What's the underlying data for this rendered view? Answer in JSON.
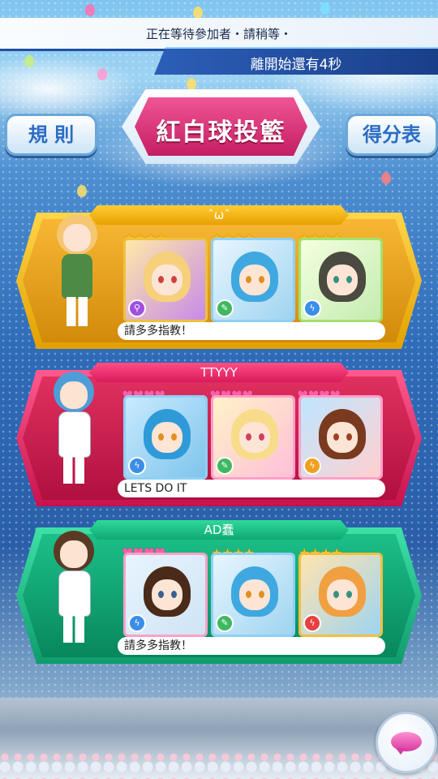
{
  "header": {
    "waiting_text": "正在等待參加者・請稍等・",
    "countdown_text": "離開始還有4秒"
  },
  "buttons": {
    "rules_label": "規 則",
    "scoreboard_label": "得分表"
  },
  "mode_title": "紅白球投籃",
  "players": [
    {
      "name": "ˆωˆ",
      "theme": "gold",
      "message": "請多多指教！",
      "cards": [
        {
          "rating_type": "star",
          "rating": 4,
          "skill_icon": "magnifier-icon",
          "skill_color": "#a050e0"
        },
        {
          "rating_type": "star",
          "rating": 4,
          "skill_icon": "wrench-icon",
          "skill_color": "#3fb860"
        },
        {
          "rating_type": "star",
          "rating": 4,
          "skill_icon": "lightning-icon",
          "skill_color": "#3a8ee8"
        }
      ]
    },
    {
      "name": "TTYYY",
      "theme": "pink",
      "message": "LETS DO IT",
      "cards": [
        {
          "rating_type": "heart",
          "rating": 4,
          "skill_icon": "lightning-icon",
          "skill_color": "#3a8ee8"
        },
        {
          "rating_type": "heart",
          "rating": 4,
          "skill_icon": "wrench-icon",
          "skill_color": "#3fb860"
        },
        {
          "rating_type": "heart",
          "rating": 4,
          "skill_icon": "lightning-icon",
          "skill_color": "#f0a020"
        }
      ]
    },
    {
      "name": "AD蠢",
      "theme": "green",
      "message": "請多多指教！",
      "cards": [
        {
          "rating_type": "heart",
          "rating": 4,
          "skill_icon": "lightning-icon",
          "skill_color": "#3a8ee8"
        },
        {
          "rating_type": "star",
          "rating": 4,
          "skill_icon": "wrench-icon",
          "skill_color": "#3fb860"
        },
        {
          "rating_type": "star",
          "rating": 4,
          "skill_icon": "lightning-icon",
          "skill_color": "#e84040"
        }
      ]
    }
  ],
  "chat_icon": "chat-bubble-icon"
}
